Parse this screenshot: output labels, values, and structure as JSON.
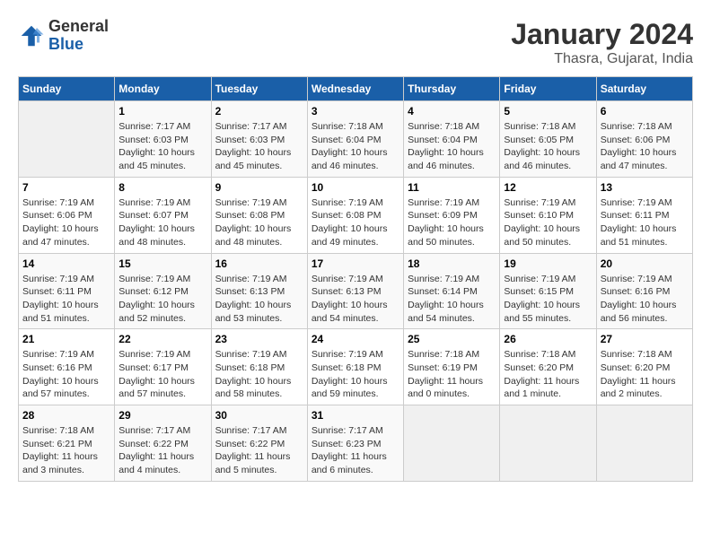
{
  "header": {
    "logo": {
      "line1": "General",
      "line2": "Blue"
    },
    "title": "January 2024",
    "subtitle": "Thasra, Gujarat, India"
  },
  "columns": [
    "Sunday",
    "Monday",
    "Tuesday",
    "Wednesday",
    "Thursday",
    "Friday",
    "Saturday"
  ],
  "weeks": [
    [
      {
        "day": "",
        "empty": true
      },
      {
        "day": "1",
        "sunrise": "7:17 AM",
        "sunset": "6:03 PM",
        "daylight": "10 hours and 45 minutes."
      },
      {
        "day": "2",
        "sunrise": "7:17 AM",
        "sunset": "6:03 PM",
        "daylight": "10 hours and 45 minutes."
      },
      {
        "day": "3",
        "sunrise": "7:18 AM",
        "sunset": "6:04 PM",
        "daylight": "10 hours and 46 minutes."
      },
      {
        "day": "4",
        "sunrise": "7:18 AM",
        "sunset": "6:04 PM",
        "daylight": "10 hours and 46 minutes."
      },
      {
        "day": "5",
        "sunrise": "7:18 AM",
        "sunset": "6:05 PM",
        "daylight": "10 hours and 46 minutes."
      },
      {
        "day": "6",
        "sunrise": "7:18 AM",
        "sunset": "6:06 PM",
        "daylight": "10 hours and 47 minutes."
      }
    ],
    [
      {
        "day": "7",
        "sunrise": "7:19 AM",
        "sunset": "6:06 PM",
        "daylight": "10 hours and 47 minutes."
      },
      {
        "day": "8",
        "sunrise": "7:19 AM",
        "sunset": "6:07 PM",
        "daylight": "10 hours and 48 minutes."
      },
      {
        "day": "9",
        "sunrise": "7:19 AM",
        "sunset": "6:08 PM",
        "daylight": "10 hours and 48 minutes."
      },
      {
        "day": "10",
        "sunrise": "7:19 AM",
        "sunset": "6:08 PM",
        "daylight": "10 hours and 49 minutes."
      },
      {
        "day": "11",
        "sunrise": "7:19 AM",
        "sunset": "6:09 PM",
        "daylight": "10 hours and 50 minutes."
      },
      {
        "day": "12",
        "sunrise": "7:19 AM",
        "sunset": "6:10 PM",
        "daylight": "10 hours and 50 minutes."
      },
      {
        "day": "13",
        "sunrise": "7:19 AM",
        "sunset": "6:11 PM",
        "daylight": "10 hours and 51 minutes."
      }
    ],
    [
      {
        "day": "14",
        "sunrise": "7:19 AM",
        "sunset": "6:11 PM",
        "daylight": "10 hours and 51 minutes."
      },
      {
        "day": "15",
        "sunrise": "7:19 AM",
        "sunset": "6:12 PM",
        "daylight": "10 hours and 52 minutes."
      },
      {
        "day": "16",
        "sunrise": "7:19 AM",
        "sunset": "6:13 PM",
        "daylight": "10 hours and 53 minutes."
      },
      {
        "day": "17",
        "sunrise": "7:19 AM",
        "sunset": "6:13 PM",
        "daylight": "10 hours and 54 minutes."
      },
      {
        "day": "18",
        "sunrise": "7:19 AM",
        "sunset": "6:14 PM",
        "daylight": "10 hours and 54 minutes."
      },
      {
        "day": "19",
        "sunrise": "7:19 AM",
        "sunset": "6:15 PM",
        "daylight": "10 hours and 55 minutes."
      },
      {
        "day": "20",
        "sunrise": "7:19 AM",
        "sunset": "6:16 PM",
        "daylight": "10 hours and 56 minutes."
      }
    ],
    [
      {
        "day": "21",
        "sunrise": "7:19 AM",
        "sunset": "6:16 PM",
        "daylight": "10 hours and 57 minutes."
      },
      {
        "day": "22",
        "sunrise": "7:19 AM",
        "sunset": "6:17 PM",
        "daylight": "10 hours and 57 minutes."
      },
      {
        "day": "23",
        "sunrise": "7:19 AM",
        "sunset": "6:18 PM",
        "daylight": "10 hours and 58 minutes."
      },
      {
        "day": "24",
        "sunrise": "7:19 AM",
        "sunset": "6:18 PM",
        "daylight": "10 hours and 59 minutes."
      },
      {
        "day": "25",
        "sunrise": "7:18 AM",
        "sunset": "6:19 PM",
        "daylight": "11 hours and 0 minutes."
      },
      {
        "day": "26",
        "sunrise": "7:18 AM",
        "sunset": "6:20 PM",
        "daylight": "11 hours and 1 minute."
      },
      {
        "day": "27",
        "sunrise": "7:18 AM",
        "sunset": "6:20 PM",
        "daylight": "11 hours and 2 minutes."
      }
    ],
    [
      {
        "day": "28",
        "sunrise": "7:18 AM",
        "sunset": "6:21 PM",
        "daylight": "11 hours and 3 minutes."
      },
      {
        "day": "29",
        "sunrise": "7:17 AM",
        "sunset": "6:22 PM",
        "daylight": "11 hours and 4 minutes."
      },
      {
        "day": "30",
        "sunrise": "7:17 AM",
        "sunset": "6:22 PM",
        "daylight": "11 hours and 5 minutes."
      },
      {
        "day": "31",
        "sunrise": "7:17 AM",
        "sunset": "6:23 PM",
        "daylight": "11 hours and 6 minutes."
      },
      {
        "day": "",
        "empty": true
      },
      {
        "day": "",
        "empty": true
      },
      {
        "day": "",
        "empty": true
      }
    ]
  ],
  "labels": {
    "sunrise_prefix": "Sunrise: ",
    "sunset_prefix": "Sunset: ",
    "daylight_prefix": "Daylight: "
  }
}
